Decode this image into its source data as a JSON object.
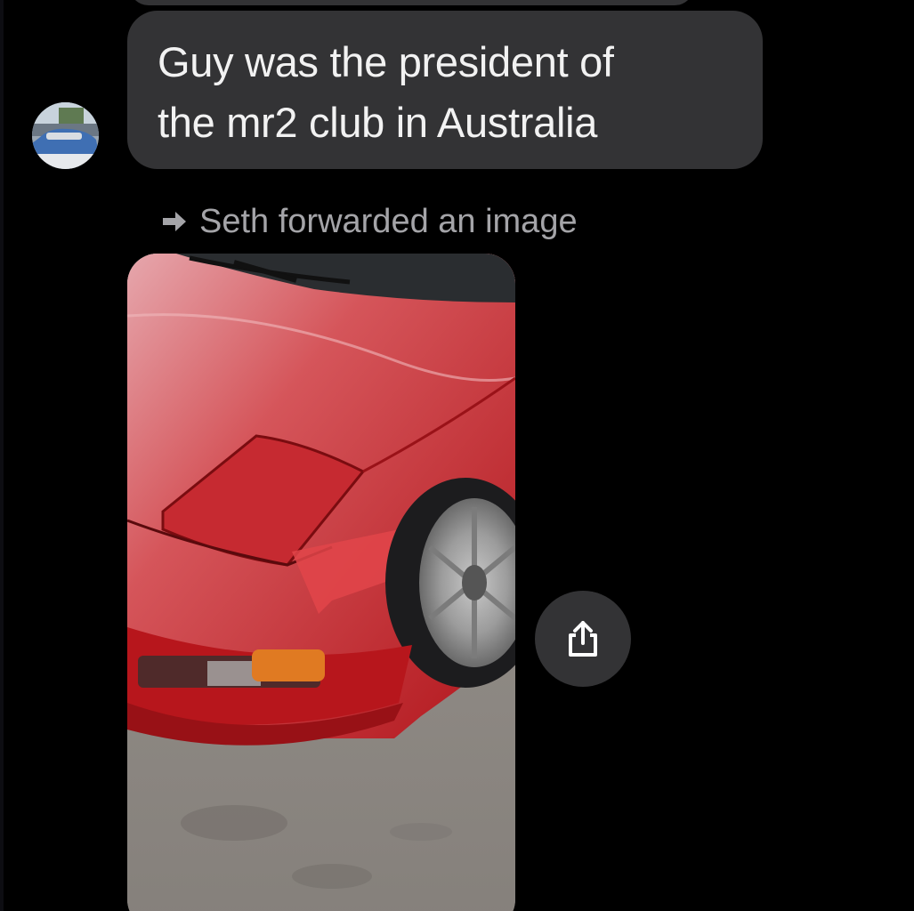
{
  "thread": {
    "received_message": {
      "lines": [
        "Guy was the president of",
        "the mr2 club in Australia"
      ]
    },
    "forward_note": {
      "text": "Seth forwarded an image"
    }
  },
  "icons": {
    "avatar": "contact-avatar-photo",
    "forward": "forward-arrow-icon",
    "share": "share-icon"
  },
  "colors": {
    "background": "#000000",
    "bubble": "#333335",
    "bubble_text": "#f2f2f2",
    "secondary_text": "#a4a4a8"
  }
}
